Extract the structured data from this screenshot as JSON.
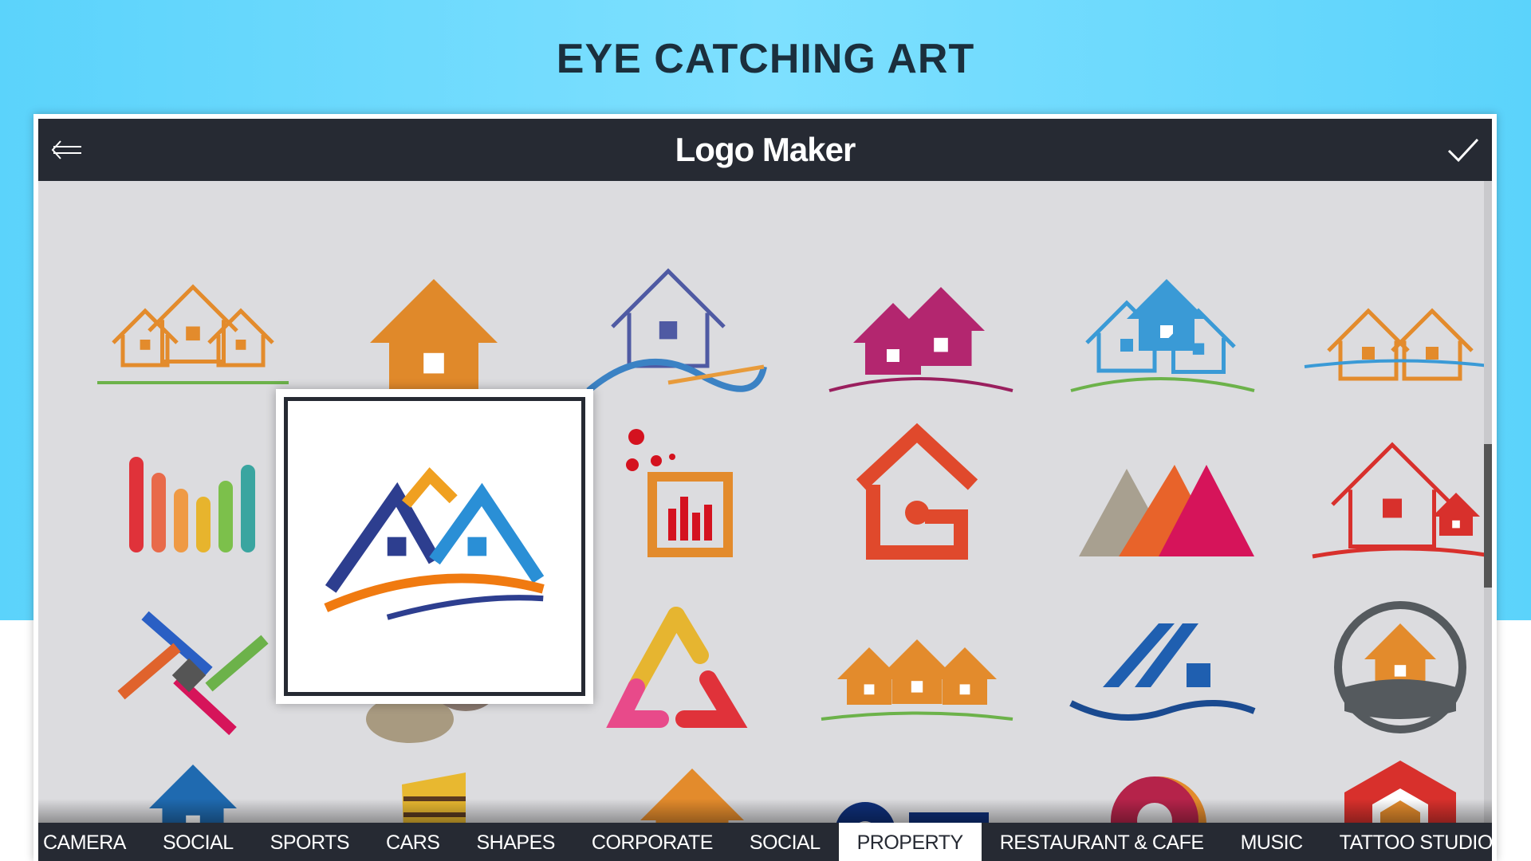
{
  "headline": "EYE CATCHING ART",
  "app": {
    "title": "Logo Maker",
    "back_icon": "back-arrow-icon",
    "confirm_icon": "checkmark-icon"
  },
  "colors": {
    "header": "#262a33",
    "grid_bg": "#dcdcdf",
    "background": "#5bd3fb"
  },
  "logos": [
    {
      "icon": "house-trio-outline",
      "colors": [
        "#e38b2c",
        "#5a3e2a",
        "#6cb24a"
      ]
    },
    {
      "icon": "house-solid",
      "colors": [
        "#e0892a",
        "#c9701c"
      ]
    },
    {
      "icon": "house-wave",
      "colors": [
        "#4f5aa3",
        "#3b82c4",
        "#e89b3b"
      ]
    },
    {
      "icon": "house-double",
      "colors": [
        "#b3266f",
        "#9a1f5e"
      ]
    },
    {
      "icon": "house-trio-blue",
      "colors": [
        "#3a9ad6",
        "#e38b2c",
        "#6cb24a"
      ]
    },
    {
      "icon": "roofs-orange",
      "colors": [
        "#e38b2c",
        "#3a9ad6"
      ]
    },
    {
      "icon": "color-bars",
      "colors": [
        "#e0323a",
        "#e86a4a",
        "#ef9a45",
        "#e7b42d",
        "#7cc04b",
        "#3aa5a0"
      ]
    },
    {
      "icon": "mountain-houses",
      "colors": [
        "#2d3e8f",
        "#f0a020",
        "#2a8fd6"
      ]
    },
    {
      "icon": "dots-chart",
      "colors": [
        "#d4121f",
        "#e38b2c"
      ]
    },
    {
      "icon": "house-key",
      "colors": [
        "#e0492c"
      ]
    },
    {
      "icon": "peaks",
      "colors": [
        "#a8a090",
        "#e8632a",
        "#d6145a"
      ]
    },
    {
      "icon": "house-red-outline",
      "colors": [
        "#d8302c"
      ]
    },
    {
      "icon": "crossed-sticks",
      "colors": [
        "#e0632c",
        "#2a5fc4",
        "#6cb24a",
        "#d6145a",
        "#555"
      ]
    },
    {
      "icon": "stones",
      "colors": [
        "#a89a80",
        "#8a7a70",
        "#c49a6a"
      ]
    },
    {
      "icon": "triangle-arrows",
      "colors": [
        "#e6b530",
        "#e84a8a",
        "#e0323a"
      ]
    },
    {
      "icon": "houses-row",
      "colors": [
        "#e38b2c",
        "#6cb24a"
      ]
    },
    {
      "icon": "roof-lines",
      "colors": [
        "#1f5fb0",
        "#1a4a90"
      ]
    },
    {
      "icon": "circle-road-house",
      "colors": [
        "#555a5e",
        "#e38b2c"
      ]
    },
    {
      "icon": "house-pin",
      "colors": [
        "#1f6ab0"
      ]
    },
    {
      "icon": "building-stripes",
      "colors": [
        "#e8b830",
        "#5a3a20"
      ]
    },
    {
      "icon": "house-swoosh",
      "colors": [
        "#e38b2c",
        "#2a8fd6"
      ]
    },
    {
      "icon": "key-city",
      "colors": [
        "#0e2f7a"
      ]
    },
    {
      "icon": "pin-swirl",
      "colors": [
        "#b5234a",
        "#e38b2c"
      ]
    },
    {
      "icon": "hexagon-cube",
      "colors": [
        "#d8302c",
        "#e38b2c",
        "#8a1030"
      ]
    }
  ],
  "selected_logo": {
    "icon": "mountain-houses",
    "colors": [
      "#2d3e8f",
      "#f0a020",
      "#2a8fd6",
      "#f07a10"
    ]
  },
  "tabs": [
    {
      "label": "CAMERA"
    },
    {
      "label": "SOCIAL"
    },
    {
      "label": "SPORTS"
    },
    {
      "label": "CARS"
    },
    {
      "label": "SHAPES"
    },
    {
      "label": "CORPORATE"
    },
    {
      "label": "SOCIAL"
    },
    {
      "label": "PROPERTY",
      "active": true
    },
    {
      "label": "RESTAURANT & CAFE"
    },
    {
      "label": "MUSIC"
    },
    {
      "label": "TATTOO STUDIO"
    }
  ]
}
